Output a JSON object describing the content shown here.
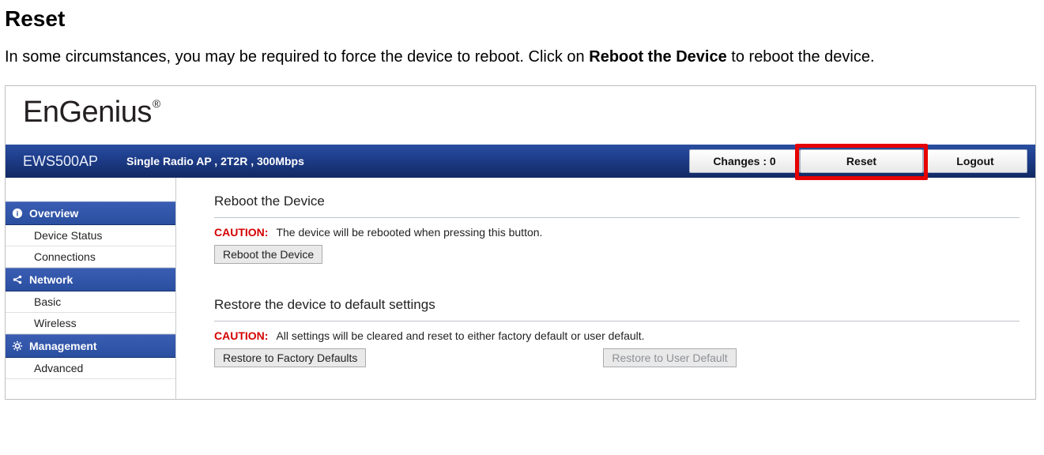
{
  "doc": {
    "title": "Reset",
    "intro_before": "In some circumstances, you may be required to force the device to reboot. Click on ",
    "intro_bold": "Reboot the Device",
    "intro_after": " to reboot the device."
  },
  "brand": {
    "name": "EnGenius",
    "reg": "®"
  },
  "header": {
    "model": "EWS500AP",
    "desc": "Single Radio AP , 2T2R , 300Mbps",
    "changes_label": "Changes : 0",
    "reset_label": "Reset",
    "logout_label": "Logout"
  },
  "sidebar": {
    "sections": [
      {
        "head": "Overview",
        "items": [
          "Device Status",
          "Connections"
        ]
      },
      {
        "head": "Network",
        "items": [
          "Basic",
          "Wireless"
        ]
      },
      {
        "head": "Management",
        "items": [
          "Advanced"
        ]
      }
    ]
  },
  "main": {
    "reboot": {
      "title": "Reboot the Device",
      "caution_label": "CAUTION:",
      "caution_text": "The device will be rebooted when pressing this button.",
      "button": "Reboot the Device"
    },
    "restore": {
      "title": "Restore the device to default settings",
      "caution_label": "CAUTION:",
      "caution_text": "All settings will be cleared and reset to either factory default or user default.",
      "factory_btn": "Restore to Factory Defaults",
      "user_btn": "Restore to User Default"
    }
  }
}
